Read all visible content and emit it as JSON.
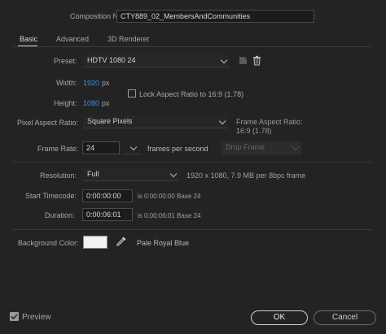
{
  "composition": {
    "name_label": "Composition Name:",
    "name_value": "CTY889_02_MembersAndCommunities"
  },
  "tabs": [
    {
      "label": "Basic"
    },
    {
      "label": "Advanced"
    },
    {
      "label": "3D Renderer"
    }
  ],
  "basic": {
    "preset_label": "Preset:",
    "preset_value": "HDTV 1080 24",
    "width_label": "Width:",
    "width_value": "1920",
    "width_unit": "px",
    "height_label": "Height:",
    "height_value": "1080",
    "height_unit": "px",
    "lock_aspect_label": "Lock Aspect Ratio to 16:9 (1.78)",
    "pixel_aspect_label": "Pixel Aspect Ratio:",
    "pixel_aspect_value": "Square Pixels",
    "frame_aspect_label": "Frame Aspect Ratio:",
    "frame_aspect_value": "16:9 (1.78)",
    "frame_rate_label": "Frame Rate:",
    "frame_rate_value": "24",
    "frame_rate_unit": "frames per second",
    "drop_frame_value": "Drop Frame",
    "resolution_label": "Resolution:",
    "resolution_value": "Full",
    "resolution_info": "1920 x 1080, 7.9 MB per 8bpc frame",
    "start_timecode_label": "Start Timecode:",
    "start_timecode_value": "0:00:00:00",
    "start_timecode_info": "is 0:00:00:00  Base 24",
    "duration_label": "Duration:",
    "duration_value": "0:00:06:01",
    "duration_info": "is 0:00:06:01  Base 24",
    "bg_color_label": "Background Color:",
    "bg_color_name": "Pale Royal Blue",
    "bg_color_hex": "#f2f2f7"
  },
  "footer": {
    "preview_label": "Preview",
    "ok_label": "OK",
    "cancel_label": "Cancel"
  }
}
